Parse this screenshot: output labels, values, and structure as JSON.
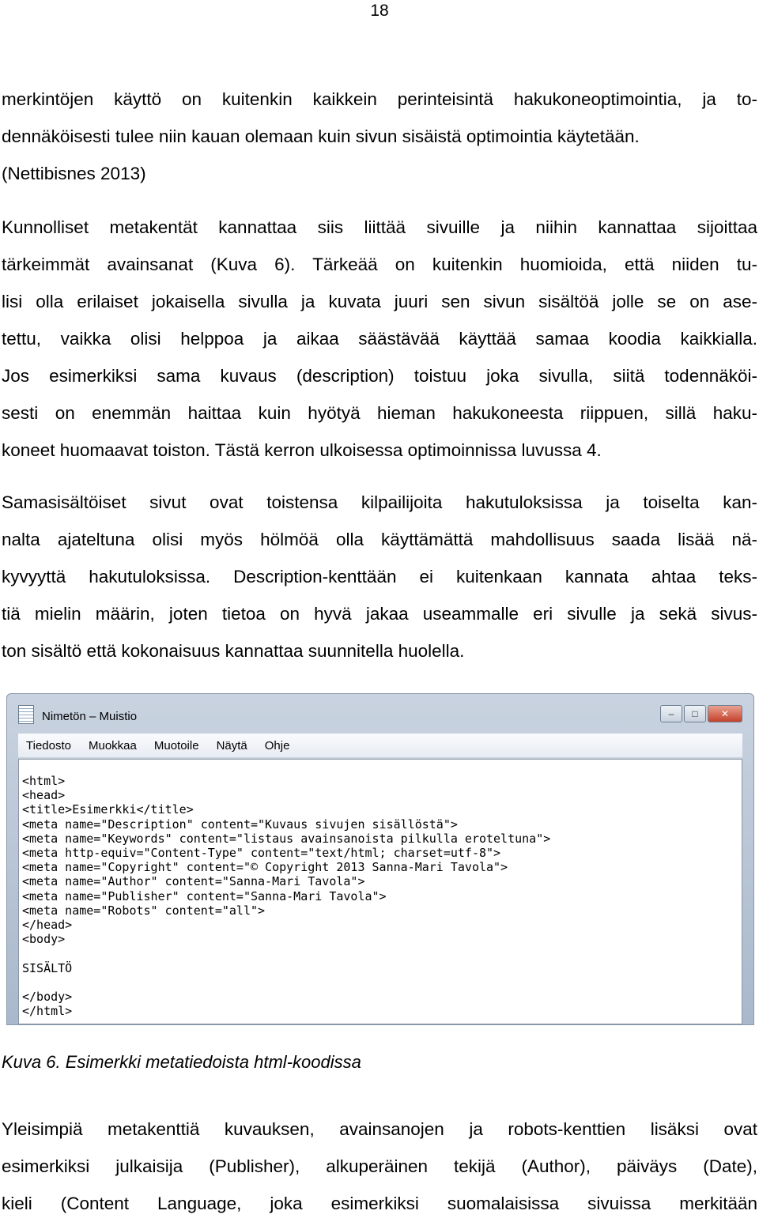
{
  "page_number": "18",
  "paragraph1": [
    "merkintöjen käyttö on kuitenkin kaikkein perinteisintä hakukoneoptimointia, ja to-",
    "dennäköisesti tulee niin kauan olemaan kuin sivun sisäistä optimointia käytetään.",
    "(Nettibisnes 2013)"
  ],
  "paragraph2": [
    "Kunnolliset metakentät kannattaa siis liittää sivuille ja niihin kannattaa sijoittaa",
    "tärkeimmät avainsanat (Kuva 6). Tärkeää on kuitenkin huomioida, että niiden tu-",
    "lisi olla erilaiset jokaisella sivulla ja kuvata juuri sen sivun sisältöä jolle se on ase-",
    "tettu, vaikka olisi helppoa ja aikaa säästävää käyttää samaa koodia kaikkialla.",
    "Jos esimerkiksi sama kuvaus (description) toistuu joka sivulla, siitä todennäköi-",
    "sesti on enemmän haittaa kuin hyötyä hieman hakukoneesta riippuen, sillä haku-",
    "koneet huomaavat toiston. Tästä kerron ulkoisessa optimoinnissa luvussa 4."
  ],
  "paragraph3": [
    "Samasisältöiset sivut ovat toistensa kilpailijoita hakutuloksissa ja toiselta kan-",
    "nalta ajateltuna olisi myös hölmöä olla käyttämättä mahdollisuus saada lisää nä-",
    "kyvyyttä hakutuloksissa. Description-kenttään ei kuitenkaan kannata ahtaa teks-",
    "tiä mielin määrin, joten tietoa on hyvä jakaa useammalle eri sivulle ja sekä sivus-",
    "ton sisältö että kokonaisuus kannattaa suunnitella huolella."
  ],
  "notepad": {
    "title": "Nimetön – Muistio",
    "menu": [
      "Tiedosto",
      "Muokkaa",
      "Muotoile",
      "Näytä",
      "Ohje"
    ],
    "buttons": {
      "minimize": "–",
      "maximize": "□",
      "close": "✕"
    },
    "code_lines": [
      "<html>",
      "<head>",
      "<title>Esimerkki</title>",
      "<meta name=\"Description\" content=\"Kuvaus sivujen sisällöstä\">",
      "<meta name=\"Keywords\" content=\"listaus avainsanoista pilkulla eroteltuna\">",
      "<meta http-equiv=\"Content-Type\" content=\"text/html; charset=utf-8\">",
      "<meta name=\"Copyright\" content=\"© Copyright 2013 Sanna-Mari Tavola\">",
      "<meta name=\"Author\" content=\"Sanna-Mari Tavola\">",
      "<meta name=\"Publisher\" content=\"Sanna-Mari Tavola\">",
      "<meta name=\"Robots\" content=\"all\">",
      "</head>",
      "<body>",
      "",
      "SISÄLTÖ",
      "",
      "</body>",
      "</html>"
    ]
  },
  "caption": "Kuva 6. Esimerkki metatiedoista html-koodissa",
  "paragraph4": [
    "Yleisimpiä metakenttiä kuvauksen, avainsanojen ja robots-kenttien lisäksi ovat",
    "esimerkiksi julkaisija (Publisher), alkuperäinen tekijä (Author), päiväys (Date),",
    "kieli (Content Language, joka esimerkiksi suomalaisissa sivuissa merkitään"
  ]
}
